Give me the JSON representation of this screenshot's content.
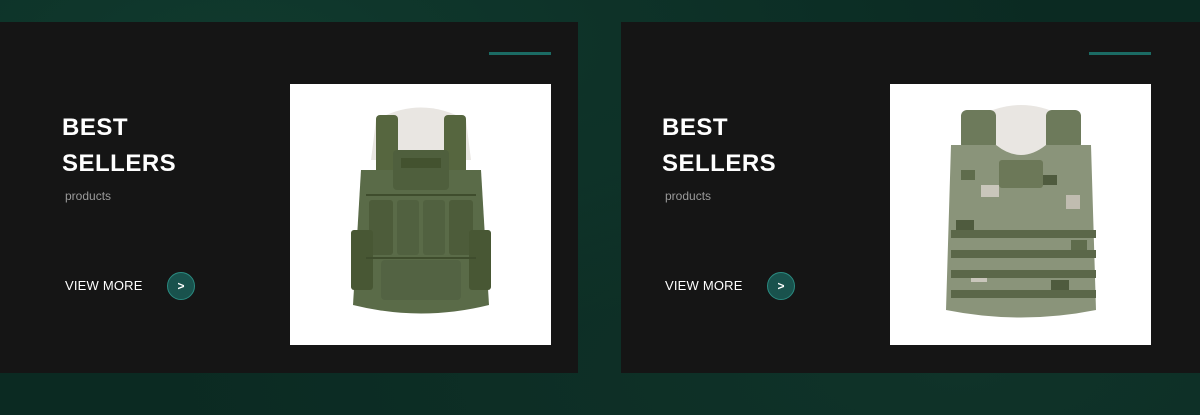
{
  "cards": [
    {
      "title_line1": "BEST",
      "title_line2": "SELLERS",
      "subtitle": "products",
      "view_more_label": "VIEW MORE",
      "arrow_label": ">",
      "product_image_icon": "olive-tactical-vest-image",
      "product_color": "#5a6b48"
    },
    {
      "title_line1": "BEST",
      "title_line2": "SELLERS",
      "subtitle": "products",
      "view_more_label": "VIEW MORE",
      "arrow_label": ">",
      "product_image_icon": "camo-tactical-vest-image",
      "product_color": "#7d8a6a"
    }
  ],
  "colors": {
    "accent": "#1b6b64",
    "card_background": "#151515",
    "page_background": "#0b2a22"
  }
}
